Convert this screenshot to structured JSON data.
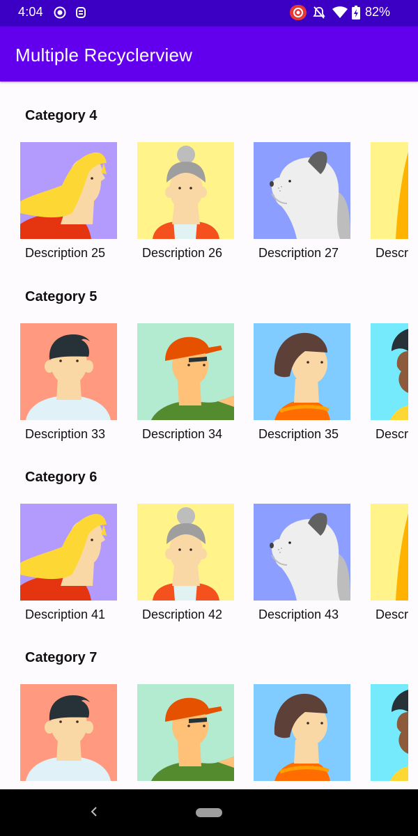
{
  "status_bar": {
    "time": "4:04",
    "battery": "82%",
    "icons": [
      "record-icon",
      "app-icon",
      "screen-record-icon",
      "mute-icon",
      "wifi-icon",
      "battery-icon"
    ]
  },
  "app_bar": {
    "title": "Multiple Recyclerview"
  },
  "categories": [
    {
      "title": "Category 4",
      "items": [
        {
          "desc": "Description 25",
          "avatar": "blonde-woman-avatar"
        },
        {
          "desc": "Description 26",
          "avatar": "grey-hair-woman-avatar"
        },
        {
          "desc": "Description 27",
          "avatar": "dog-avatar"
        },
        {
          "desc": "Descri",
          "avatar": "partial-avatar"
        }
      ]
    },
    {
      "title": "Category 5",
      "items": [
        {
          "desc": "Description 33",
          "avatar": "dark-hair-man-avatar"
        },
        {
          "desc": "Description 34",
          "avatar": "cap-man-avatar"
        },
        {
          "desc": "Description 35",
          "avatar": "brown-hair-woman-avatar"
        },
        {
          "desc": "Descri",
          "avatar": "partial-avatar"
        }
      ]
    },
    {
      "title": "Category 6",
      "items": [
        {
          "desc": "Description 41",
          "avatar": "blonde-woman-avatar"
        },
        {
          "desc": "Description 42",
          "avatar": "grey-hair-woman-avatar"
        },
        {
          "desc": "Description 43",
          "avatar": "dog-avatar"
        },
        {
          "desc": "Descri",
          "avatar": "partial-avatar"
        }
      ]
    },
    {
      "title": "Category 7",
      "items": [
        {
          "desc": "",
          "avatar": "dark-hair-man-avatar"
        },
        {
          "desc": "",
          "avatar": "cap-man-avatar"
        },
        {
          "desc": "",
          "avatar": "brown-hair-woman-avatar"
        },
        {
          "desc": "",
          "avatar": "partial-avatar"
        }
      ]
    }
  ],
  "colors": {
    "status_bar": "#3b00c4",
    "app_bar": "#6200ee",
    "background": "#fdfbfe"
  }
}
